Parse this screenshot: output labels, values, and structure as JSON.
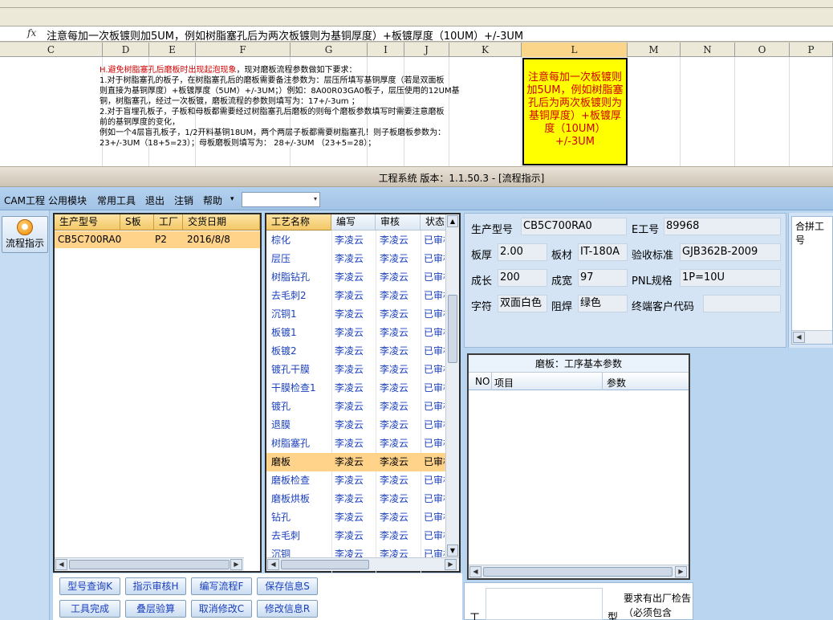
{
  "excel": {
    "formula_text": "注意每加一次板镀则加5UM，例如树脂塞孔后为两次板镀则为基铜厚度）+板镀厚度（10UM）+/-3UM",
    "fx_symbol": "fx",
    "columns": [
      "C",
      "D",
      "E",
      "F",
      "G",
      "I",
      "J",
      "K",
      "L",
      "M",
      "N",
      "O",
      "P"
    ],
    "selected_column": "L",
    "note_heading": "H.避免树脂塞孔后磨板时出现起泡现象",
    "note_heading_tail": "，现对磨板流程参数做如下要求：",
    "note_lines": [
      "1.对于树脂塞孔的板子，在树脂塞孔后的磨板需要备注参数为：层压所填写基铜厚度（若是双面板",
      "则直接为基铜厚度）+板镀厚度（5UM）+/-3UM；）例如：8A00R03GA0板子，层压使用的12UM基",
      "铜，树脂塞孔，经过一次板镀，磨板流程的参数则填写为：17+/-3um ；",
      "2.对于盲埋孔板子，子板和母板都需要经过树脂塞孔后磨板的则每个磨板参数填写时需要注意磨板",
      "前的基铜厚度的变化，",
      "例如一个4层盲孔板子，1/2开料基铜18UM，两个两层子板都需要树脂塞孔！则子板磨板参数为：",
      "23+/-3UM（18+5=23）；母板磨板则填写为： 28+/-3UM （23+5=28）；"
    ],
    "highlight_cell": "注意每加一次板镀则加5UM，例如树脂塞孔后为两次板镀则为基铜厚度）+板镀厚度（10UM）+/-3UM"
  },
  "app": {
    "title": "工程系统  版本：1.1.50.3 - [流程指示]",
    "menu": [
      "CAM工程",
      "公用模块",
      "常用工具",
      "退出",
      "注销",
      "帮助"
    ],
    "menu_dropdown_arrow": "▾",
    "side_button_label": "流程指示",
    "orders": {
      "headers": [
        "生产型号",
        "S板",
        "工厂",
        "交货日期"
      ],
      "rows": [
        {
          "model": "CB5C700RA0",
          "s": "",
          "factory": "P2",
          "date": "2016/8/8"
        }
      ]
    },
    "process": {
      "headers": [
        "工艺名称",
        "编写",
        "审核",
        "状态"
      ],
      "selected_index": 12,
      "rows": [
        {
          "name": "棕化",
          "writer": "李凌云",
          "reviewer": "李凌云",
          "status": "已审核"
        },
        {
          "name": "层压",
          "writer": "李凌云",
          "reviewer": "李凌云",
          "status": "已审核"
        },
        {
          "name": "树脂钻孔",
          "writer": "李凌云",
          "reviewer": "李凌云",
          "status": "已审核"
        },
        {
          "name": "去毛刺2",
          "writer": "李凌云",
          "reviewer": "李凌云",
          "status": "已审核"
        },
        {
          "name": "沉铜1",
          "writer": "李凌云",
          "reviewer": "李凌云",
          "status": "已审核"
        },
        {
          "name": "板镀1",
          "writer": "李凌云",
          "reviewer": "李凌云",
          "status": "已审核"
        },
        {
          "name": "板镀2",
          "writer": "李凌云",
          "reviewer": "李凌云",
          "status": "已审核"
        },
        {
          "name": "镀孔干膜",
          "writer": "李凌云",
          "reviewer": "李凌云",
          "status": "已审核"
        },
        {
          "name": "干膜检查1",
          "writer": "李凌云",
          "reviewer": "李凌云",
          "status": "已审核"
        },
        {
          "name": "镀孔",
          "writer": "李凌云",
          "reviewer": "李凌云",
          "status": "已审核"
        },
        {
          "name": "退膜",
          "writer": "李凌云",
          "reviewer": "李凌云",
          "status": "已审核"
        },
        {
          "name": "树脂塞孔",
          "writer": "李凌云",
          "reviewer": "李凌云",
          "status": "已审核"
        },
        {
          "name": "磨板",
          "writer": "李凌云",
          "reviewer": "李凌云",
          "status": "已审核"
        },
        {
          "name": "磨板检查",
          "writer": "李凌云",
          "reviewer": "李凌云",
          "status": "已审核"
        },
        {
          "name": "磨板烘板",
          "writer": "李凌云",
          "reviewer": "李凌云",
          "status": "已审核"
        },
        {
          "name": "钻孔",
          "writer": "李凌云",
          "reviewer": "李凌云",
          "status": "已审核"
        },
        {
          "name": "去毛刺",
          "writer": "李凌云",
          "reviewer": "李凌云",
          "status": "已审核"
        },
        {
          "name": "沉铜",
          "writer": "李凌云",
          "reviewer": "李凌云",
          "status": "已审核"
        }
      ]
    },
    "buttons": [
      "型号查询K",
      "指示审核H",
      "编写流程F",
      "保存信息S",
      "工具完成",
      "叠层验算",
      "取消修改C",
      "修改信息R"
    ],
    "info": {
      "model_label": "生产型号",
      "model": "CB5C700RA0",
      "eno_label": "E工号",
      "eno": "89968",
      "thickness_label": "板厚",
      "thickness": "2.00",
      "material_label": "板材",
      "material": "IT-180A",
      "standard_label": "验收标准",
      "standard": "GJB362B-2009",
      "length_label": "成长",
      "length": "200",
      "width_label": "成宽",
      "width": "97",
      "pnl_label": "PNL规格",
      "pnl": "1P=10U",
      "char_label": "字符",
      "char": "双面白色",
      "mask_label": "阻焊",
      "mask": "绿色",
      "customer_label": "终端客户代码",
      "customer": ""
    },
    "merge_label": "合拼工号",
    "grind": {
      "title": "磨板：工序基本参数",
      "cols": [
        "NO",
        "项目",
        "参数"
      ]
    },
    "bottom": {
      "left_char": "工",
      "type_char": "型",
      "note": "要求有出厂检告（必须包含"
    }
  }
}
